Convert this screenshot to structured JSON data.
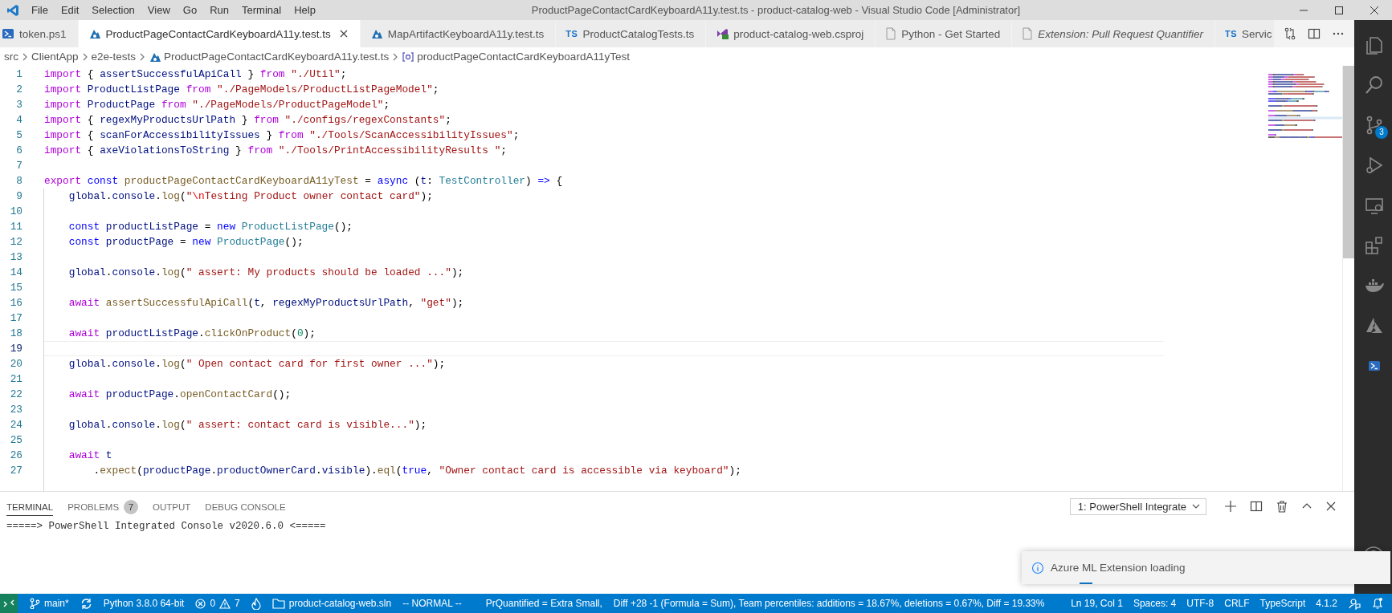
{
  "menu": [
    "File",
    "Edit",
    "Selection",
    "View",
    "Go",
    "Run",
    "Terminal",
    "Help"
  ],
  "window": {
    "title": "ProductPageContactCardKeyboardA11y.test.ts - product-catalog-web - Visual Studio Code [Administrator]"
  },
  "tabs": [
    {
      "label": "token.ps1",
      "kind": "powershell",
      "selected": false,
      "preview": false
    },
    {
      "label": "ProductPageContactCardKeyboardA11y.test.ts",
      "kind": "test",
      "selected": true,
      "preview": false
    },
    {
      "label": "MapArtifactKeyboardA11y.test.ts",
      "kind": "test",
      "selected": false,
      "preview": false
    },
    {
      "label": "ProductCatalogTests.ts",
      "kind": "ts",
      "icon_text": "TS",
      "selected": false,
      "preview": false
    },
    {
      "label": "product-catalog-web.csproj",
      "kind": "csproj",
      "selected": false,
      "preview": false
    },
    {
      "label": "Python - Get Started",
      "kind": "file",
      "selected": false,
      "preview": false
    },
    {
      "label": "Extension: Pull Request Quantifier",
      "kind": "file",
      "selected": false,
      "preview": true
    },
    {
      "label": "Servic",
      "kind": "ts",
      "icon_text": "TS",
      "selected": false,
      "preview": false
    }
  ],
  "breadcrumb": [
    {
      "label": "src"
    },
    {
      "label": "ClientApp"
    },
    {
      "label": "e2e-tests"
    },
    {
      "label": "ProductPageContactCardKeyboardA11y.test.ts",
      "kind": "test"
    },
    {
      "label": "productPageContactCardKeyboardA11yTest",
      "kind": "symbol"
    }
  ],
  "editor": {
    "lines": [
      {
        "number": "1",
        "current": false,
        "tokens": [
          {
            "text": "import",
            "kind": "ctl"
          },
          {
            "text": " { ",
            "kind": "p"
          },
          {
            "text": "assertSuccessfulApiCall",
            "kind": "var"
          },
          {
            "text": " } ",
            "kind": "p"
          },
          {
            "text": "from",
            "kind": "ctl"
          },
          {
            "text": " \"./Util\"",
            "kind": "str"
          },
          {
            "text": ";",
            "kind": "p"
          }
        ]
      },
      {
        "number": "2",
        "current": false,
        "tokens": [
          {
            "text": "import",
            "kind": "ctl"
          },
          {
            "text": " ProductListPage",
            "kind": "var"
          },
          {
            "text": " from",
            "kind": "ctl"
          },
          {
            "text": " \"./PageModels/ProductListPageModel\"",
            "kind": "str"
          },
          {
            "text": ";",
            "kind": "p"
          }
        ]
      },
      {
        "number": "3",
        "current": false,
        "tokens": [
          {
            "text": "import",
            "kind": "ctl"
          },
          {
            "text": " ProductPage",
            "kind": "var"
          },
          {
            "text": " from",
            "kind": "ctl"
          },
          {
            "text": " \"./PageModels/ProductPageModel\"",
            "kind": "str"
          },
          {
            "text": ";",
            "kind": "p"
          }
        ]
      },
      {
        "number": "4",
        "current": false,
        "tokens": [
          {
            "text": "import",
            "kind": "ctl"
          },
          {
            "text": " { ",
            "kind": "p"
          },
          {
            "text": "regexMyProductsUrlPath",
            "kind": "var"
          },
          {
            "text": " } ",
            "kind": "p"
          },
          {
            "text": "from",
            "kind": "ctl"
          },
          {
            "text": " \"./configs/regexConstants\"",
            "kind": "str"
          },
          {
            "text": ";",
            "kind": "p"
          }
        ]
      },
      {
        "number": "5",
        "current": false,
        "tokens": [
          {
            "text": "import",
            "kind": "ctl"
          },
          {
            "text": " { ",
            "kind": "p"
          },
          {
            "text": "scanForAccessibilityIssues",
            "kind": "var"
          },
          {
            "text": " } ",
            "kind": "p"
          },
          {
            "text": "from",
            "kind": "ctl"
          },
          {
            "text": " \"./Tools/ScanAccessibilityIssues\"",
            "kind": "str"
          },
          {
            "text": ";",
            "kind": "p"
          }
        ]
      },
      {
        "number": "6",
        "current": false,
        "tokens": [
          {
            "text": "import",
            "kind": "ctl"
          },
          {
            "text": " { ",
            "kind": "p"
          },
          {
            "text": "axeViolationsToString",
            "kind": "var"
          },
          {
            "text": " } ",
            "kind": "p"
          },
          {
            "text": "from",
            "kind": "ctl"
          },
          {
            "text": " \"./Tools/PrintAccessibilityResults \"",
            "kind": "str"
          },
          {
            "text": ";",
            "kind": "p"
          }
        ]
      },
      {
        "number": "7",
        "current": false
      },
      {
        "number": "8",
        "current": false,
        "tokens": [
          {
            "text": "export",
            "kind": "ctl"
          },
          {
            "text": " const",
            "kind": "kw"
          },
          {
            "text": " productPageContactCardKeyboardA11yTest",
            "kind": "fn"
          },
          {
            "text": " = ",
            "kind": "p"
          },
          {
            "text": "async",
            "kind": "kw"
          },
          {
            "text": " (",
            "kind": "p"
          },
          {
            "text": "t",
            "kind": "var"
          },
          {
            "text": ": ",
            "kind": "p"
          },
          {
            "text": "TestController",
            "kind": "type"
          },
          {
            "text": ") ",
            "kind": "p"
          },
          {
            "text": "=>",
            "kind": "kw"
          },
          {
            "text": " {",
            "kind": "p"
          }
        ]
      },
      {
        "number": "9",
        "current": false,
        "tokens": [
          {
            "text": "    global",
            "kind": "var"
          },
          {
            "text": ".",
            "kind": "p"
          },
          {
            "text": "console",
            "kind": "var"
          },
          {
            "text": ".",
            "kind": "p"
          },
          {
            "text": "log",
            "kind": "fn"
          },
          {
            "text": "(",
            "kind": "p"
          },
          {
            "text": "\"",
            "kind": "str"
          },
          {
            "text": "\\n",
            "kind": "esc"
          },
          {
            "text": "Testing Product owner contact card\"",
            "kind": "str"
          },
          {
            "text": ");",
            "kind": "p"
          }
        ]
      },
      {
        "number": "10",
        "current": false
      },
      {
        "number": "11",
        "current": false,
        "tokens": [
          {
            "text": "    const",
            "kind": "kw"
          },
          {
            "text": " productListPage",
            "kind": "var"
          },
          {
            "text": " = ",
            "kind": "p"
          },
          {
            "text": "new",
            "kind": "kw"
          },
          {
            "text": " ProductListPage",
            "kind": "type"
          },
          {
            "text": "();",
            "kind": "p"
          }
        ]
      },
      {
        "number": "12",
        "current": false,
        "tokens": [
          {
            "text": "    const",
            "kind": "kw"
          },
          {
            "text": " productPage",
            "kind": "var"
          },
          {
            "text": " = ",
            "kind": "p"
          },
          {
            "text": "new",
            "kind": "kw"
          },
          {
            "text": " ProductPage",
            "kind": "type"
          },
          {
            "text": "();",
            "kind": "p"
          }
        ]
      },
      {
        "number": "13",
        "current": false
      },
      {
        "number": "14",
        "current": false,
        "tokens": [
          {
            "text": "    global",
            "kind": "var"
          },
          {
            "text": ".",
            "kind": "p"
          },
          {
            "text": "console",
            "kind": "var"
          },
          {
            "text": ".",
            "kind": "p"
          },
          {
            "text": "log",
            "kind": "fn"
          },
          {
            "text": "(",
            "kind": "p"
          },
          {
            "text": "\" assert: My products should be loaded ...\"",
            "kind": "str"
          },
          {
            "text": ");",
            "kind": "p"
          }
        ]
      },
      {
        "number": "15",
        "current": false
      },
      {
        "number": "16",
        "current": false,
        "tokens": [
          {
            "text": "    await",
            "kind": "ctl"
          },
          {
            "text": " assertSuccessfulApiCall",
            "kind": "fn"
          },
          {
            "text": "(",
            "kind": "p"
          },
          {
            "text": "t",
            "kind": "var"
          },
          {
            "text": ", ",
            "kind": "p"
          },
          {
            "text": "regexMyProductsUrlPath",
            "kind": "var"
          },
          {
            "text": ", ",
            "kind": "p"
          },
          {
            "text": "\"get\"",
            "kind": "str"
          },
          {
            "text": ");",
            "kind": "p"
          }
        ]
      },
      {
        "number": "17",
        "current": false
      },
      {
        "number": "18",
        "current": false,
        "tokens": [
          {
            "text": "    await",
            "kind": "ctl"
          },
          {
            "text": " productListPage",
            "kind": "var"
          },
          {
            "text": ".",
            "kind": "p"
          },
          {
            "text": "clickOnProduct",
            "kind": "fn"
          },
          {
            "text": "(",
            "kind": "p"
          },
          {
            "text": "0",
            "kind": "num"
          },
          {
            "text": ");",
            "kind": "p"
          }
        ]
      },
      {
        "number": "19",
        "current": true
      },
      {
        "number": "20",
        "current": false,
        "tokens": [
          {
            "text": "    global",
            "kind": "var"
          },
          {
            "text": ".",
            "kind": "p"
          },
          {
            "text": "console",
            "kind": "var"
          },
          {
            "text": ".",
            "kind": "p"
          },
          {
            "text": "log",
            "kind": "fn"
          },
          {
            "text": "(",
            "kind": "p"
          },
          {
            "text": "\" Open contact card for first owner ...\"",
            "kind": "str"
          },
          {
            "text": ");",
            "kind": "p"
          }
        ]
      },
      {
        "number": "21",
        "current": false
      },
      {
        "number": "22",
        "current": false,
        "tokens": [
          {
            "text": "    await",
            "kind": "ctl"
          },
          {
            "text": " productPage",
            "kind": "var"
          },
          {
            "text": ".",
            "kind": "p"
          },
          {
            "text": "openContactCard",
            "kind": "fn"
          },
          {
            "text": "();",
            "kind": "p"
          }
        ]
      },
      {
        "number": "23",
        "current": false
      },
      {
        "number": "24",
        "current": false,
        "tokens": [
          {
            "text": "    global",
            "kind": "var"
          },
          {
            "text": ".",
            "kind": "p"
          },
          {
            "text": "console",
            "kind": "var"
          },
          {
            "text": ".",
            "kind": "p"
          },
          {
            "text": "log",
            "kind": "fn"
          },
          {
            "text": "(",
            "kind": "p"
          },
          {
            "text": "\" assert: contact card is visible...\"",
            "kind": "str"
          },
          {
            "text": ");",
            "kind": "p"
          }
        ]
      },
      {
        "number": "25",
        "current": false
      },
      {
        "number": "26",
        "current": false,
        "tokens": [
          {
            "text": "    await",
            "kind": "ctl"
          },
          {
            "text": " t",
            "kind": "var"
          }
        ]
      },
      {
        "number": "27",
        "current": false,
        "tokens": [
          {
            "text": "        .",
            "kind": "p"
          },
          {
            "text": "expect",
            "kind": "fn"
          },
          {
            "text": "(",
            "kind": "p"
          },
          {
            "text": "productPage",
            "kind": "var"
          },
          {
            "text": ".",
            "kind": "p"
          },
          {
            "text": "productOwnerCard",
            "kind": "var"
          },
          {
            "text": ".",
            "kind": "p"
          },
          {
            "text": "visible",
            "kind": "var"
          },
          {
            "text": ").",
            "kind": "p"
          },
          {
            "text": "eql",
            "kind": "fn"
          },
          {
            "text": "(",
            "kind": "p"
          },
          {
            "text": "true",
            "kind": "kw"
          },
          {
            "text": ", ",
            "kind": "p"
          },
          {
            "text": "\"Owner contact card is accessible via keyboard\"",
            "kind": "str"
          },
          {
            "text": ");",
            "kind": "p"
          }
        ]
      }
    ]
  },
  "activity_bar": {
    "items": [
      {
        "kind": "files"
      },
      {
        "kind": "search"
      },
      {
        "kind": "source-control",
        "badge": "3"
      },
      {
        "kind": "run"
      },
      {
        "kind": "remote"
      },
      {
        "kind": "extensions"
      },
      {
        "kind": "docker"
      },
      {
        "kind": "azure"
      },
      {
        "kind": "powershell"
      }
    ],
    "account": {
      "kind": "account"
    }
  },
  "panel": {
    "tabs": [
      {
        "label": "TERMINAL",
        "selected": true
      },
      {
        "label": "PROBLEMS",
        "selected": false,
        "badge": "7"
      },
      {
        "label": "OUTPUT",
        "selected": false
      },
      {
        "label": "DEBUG CONSOLE",
        "selected": false
      }
    ],
    "terminal_select": "1: PowerShell Integrate",
    "terminal_lines": [
      "=====> PowerShell Integrated Console v2020.6.0 <====="
    ]
  },
  "notification": {
    "message": "Azure ML Extension loading"
  },
  "status_bar": {
    "left": [
      {
        "kind": "remote"
      },
      {
        "kind": "branch",
        "text": "main*"
      },
      {
        "kind": "sync"
      },
      {
        "kind": "text",
        "text": "Python 3.8.0 64-bit"
      },
      {
        "kind": "problems",
        "errors": "0",
        "warnings": "7"
      },
      {
        "kind": "flame"
      },
      {
        "kind": "folder",
        "text": "product-catalog-web.sln"
      },
      {
        "kind": "text",
        "text": "-- NORMAL --"
      },
      {
        "kind": "text",
        "text": "PrQuantified = Extra Small,"
      },
      {
        "kind": "text",
        "text": "Diff +28 -1 (Formula = Sum),  Team percentiles: additions = 18.67%, deletions = 0.67%, Diff = 19.33%"
      }
    ],
    "right": [
      {
        "kind": "text",
        "text": "Ln 19, Col 1"
      },
      {
        "kind": "text",
        "text": "Spaces: 4"
      },
      {
        "kind": "text",
        "text": "UTF-8"
      },
      {
        "kind": "text",
        "text": "CRLF"
      },
      {
        "kind": "text",
        "text": "TypeScript"
      },
      {
        "kind": "text",
        "text": "4.1.2"
      },
      {
        "kind": "feedback"
      },
      {
        "kind": "bell"
      }
    ]
  }
}
